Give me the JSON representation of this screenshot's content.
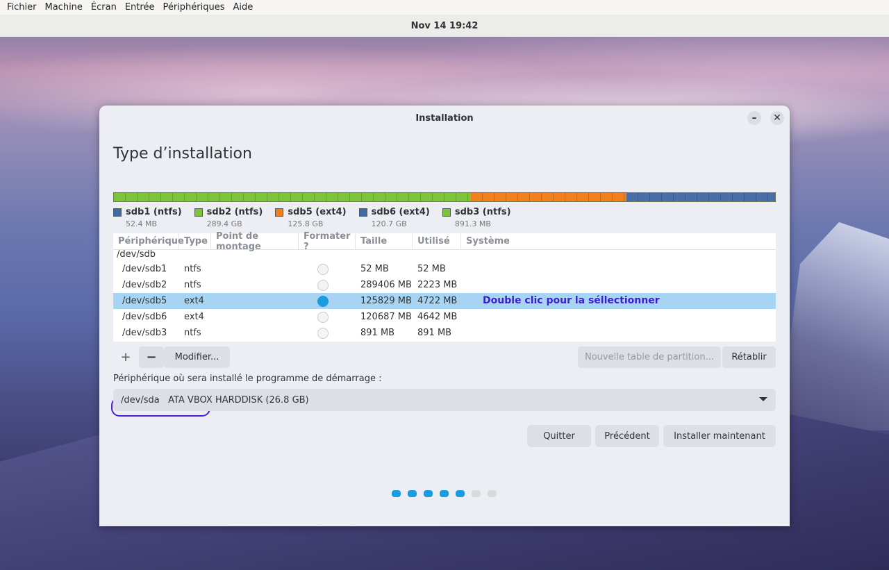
{
  "menubar": [
    "Fichier",
    "Machine",
    "Écran",
    "Entrée",
    "Périphériques",
    "Aide"
  ],
  "topbar": {
    "datetime": "Nov 14  19:42"
  },
  "window": {
    "title": "Installation",
    "minimize": "–",
    "close": "✕"
  },
  "page": {
    "heading": "Type d’installation"
  },
  "partition_bar": [
    {
      "name": "sdb2",
      "color": "#7cc43a",
      "fraction": 0.54
    },
    {
      "name": "sdb5",
      "color": "#f07f1c",
      "fraction": 0.235
    },
    {
      "name": "sdb6",
      "color": "#4a6ea8",
      "fraction": 0.225
    }
  ],
  "legend": [
    {
      "label": "sdb1 (ntfs)",
      "size": "52.4 MB",
      "color": "#3f6aa4"
    },
    {
      "label": "sdb2 (ntfs)",
      "size": "289.4 GB",
      "color": "#7cc43a"
    },
    {
      "label": "sdb5 (ext4)",
      "size": "125.8 GB",
      "color": "#f07f1c"
    },
    {
      "label": "sdb6 (ext4)",
      "size": "120.7 GB",
      "color": "#3f6aa4"
    },
    {
      "label": "sdb3 (ntfs)",
      "size": "891.3 MB",
      "color": "#7cc43a"
    }
  ],
  "table": {
    "headers": [
      "Périphérique",
      "Type",
      "Point de montage",
      "Formater ?",
      "Taille",
      "Utilisé",
      "Système"
    ],
    "root_device": "/dev/sdb",
    "rows": [
      {
        "device": "/dev/sdb1",
        "type": "ntfs",
        "mount": "",
        "format": false,
        "size": "52 MB",
        "used": "52 MB",
        "system": ""
      },
      {
        "device": "/dev/sdb2",
        "type": "ntfs",
        "mount": "",
        "format": false,
        "size": "289406 MB",
        "used": "2223 MB",
        "system": ""
      },
      {
        "device": "/dev/sdb5",
        "type": "ext4",
        "mount": "",
        "format": true,
        "size": "125829 MB",
        "used": "4722 MB",
        "system": ""
      },
      {
        "device": "/dev/sdb6",
        "type": "ext4",
        "mount": "",
        "format": false,
        "size": "120687 MB",
        "used": "4642 MB",
        "system": ""
      },
      {
        "device": "/dev/sdb3",
        "type": "ntfs",
        "mount": "",
        "format": false,
        "size": "891 MB",
        "used": "891 MB",
        "system": ""
      }
    ],
    "selected_hint": "Double clic pour la séllectionner"
  },
  "toolbar": {
    "add": "+",
    "remove": "−",
    "modify": "Modifier...",
    "new_table": "Nouvelle table de partition...",
    "reset": "Rétablir"
  },
  "boot": {
    "label": "Périphérique où sera installé le programme de démarrage :",
    "value": "/dev/sda   ATA VBOX HARDDISK (26.8 GB)"
  },
  "actions": {
    "quit": "Quitter",
    "previous": "Précédent",
    "install": "Installer maintenant"
  },
  "progress": {
    "total_steps": 7,
    "completed_steps": 5
  }
}
